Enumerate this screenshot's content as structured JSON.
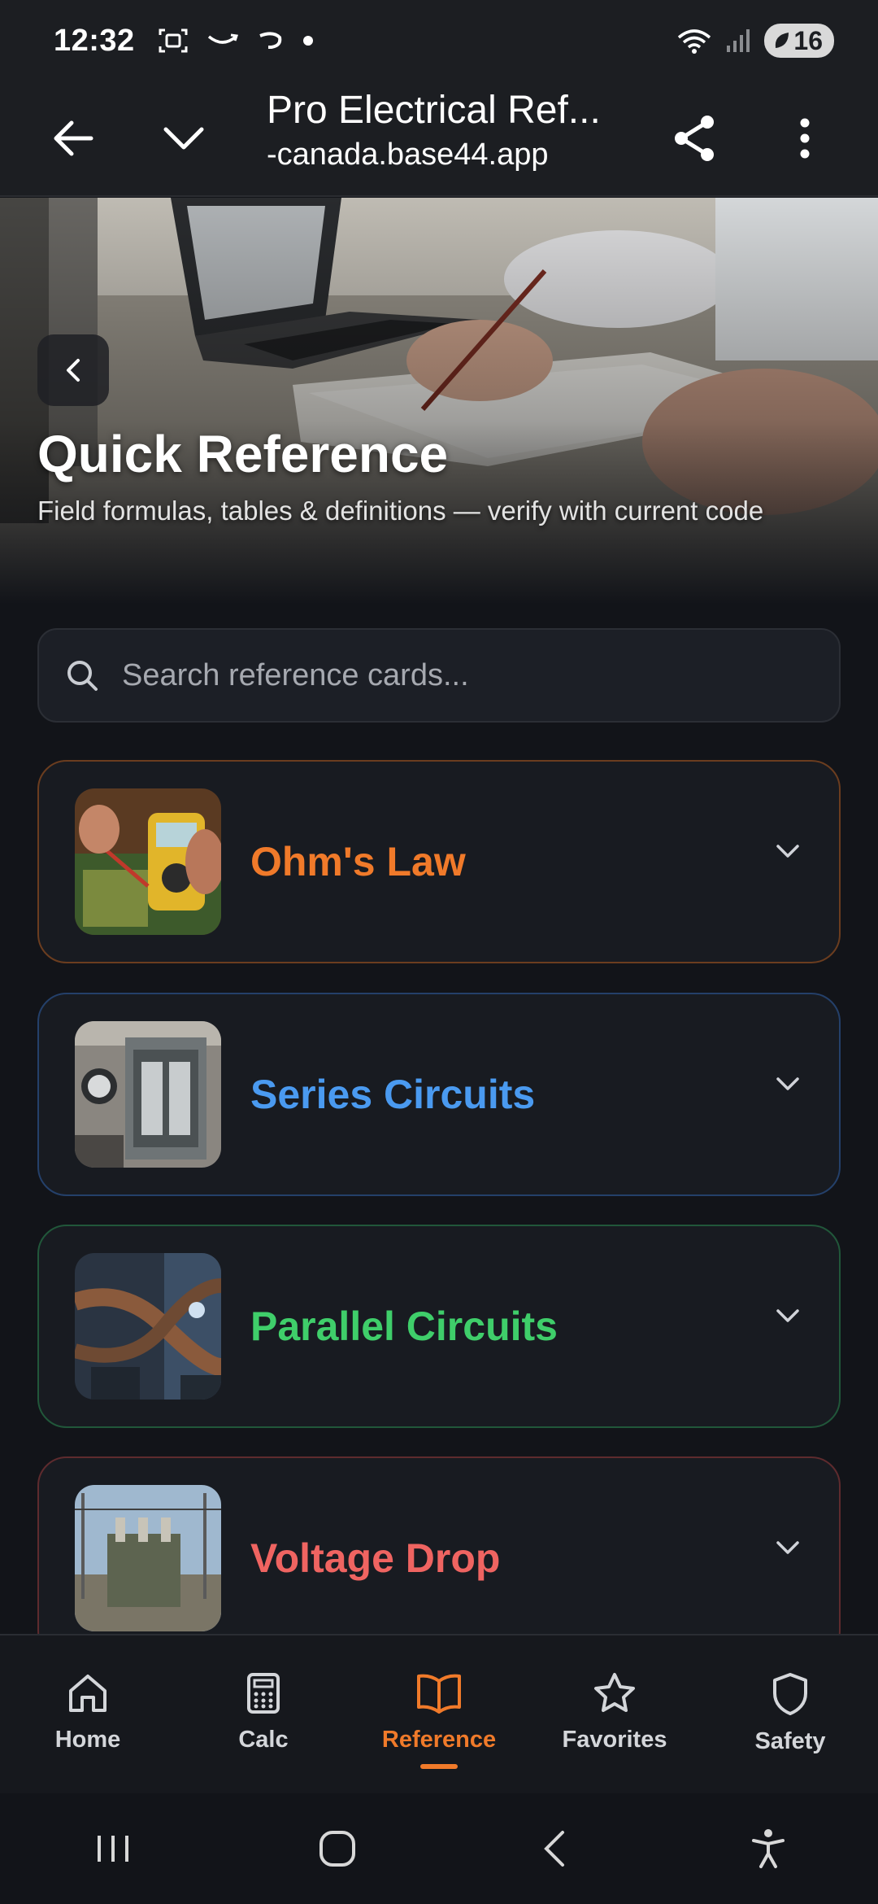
{
  "status_bar": {
    "time": "12:32",
    "battery": "16"
  },
  "browser": {
    "page_title": "Pro Electrical Ref...",
    "url": "-canada.base44.app"
  },
  "hero": {
    "title": "Quick Reference",
    "subtitle": "Field formulas, tables & definitions — verify with current code"
  },
  "search": {
    "placeholder": "Search reference cards...",
    "value": ""
  },
  "cards": [
    {
      "title": "Ohm's Law",
      "color": "#f07a2a",
      "border": "#6b3d1f"
    },
    {
      "title": "Series Circuits",
      "color": "#4a9af0",
      "border": "#24406a"
    },
    {
      "title": "Parallel Circuits",
      "color": "#3fce6a",
      "border": "#21573a"
    },
    {
      "title": "Voltage Drop",
      "color": "#ef6461",
      "border": "#5e2b2e"
    }
  ],
  "bottom_nav": {
    "items": [
      {
        "label": "Home",
        "icon": "home-icon"
      },
      {
        "label": "Calc",
        "icon": "calculator-icon"
      },
      {
        "label": "Reference",
        "icon": "book-icon",
        "active": true
      },
      {
        "label": "Favorites",
        "icon": "star-icon"
      },
      {
        "label": "Safety",
        "icon": "shield-icon"
      }
    ],
    "active_color": "#f07a2a",
    "inactive_color": "#d4d6da"
  }
}
